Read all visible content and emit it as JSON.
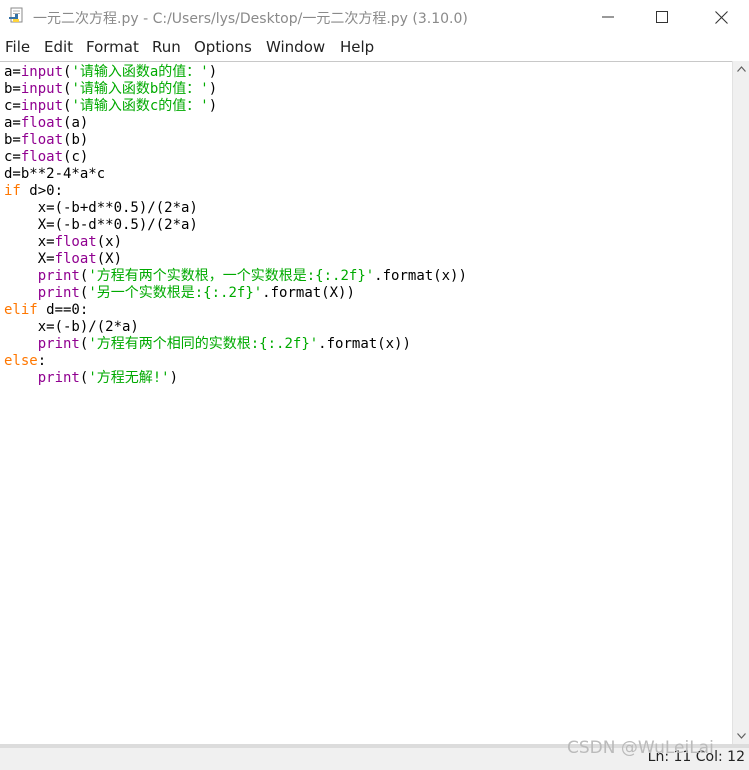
{
  "window": {
    "title": "一元二次方程.py - C:/Users/lys/Desktop/一元二次方程.py (3.10.0)"
  },
  "menu": [
    "File",
    "Edit",
    "Format",
    "Run",
    "Options",
    "Window",
    "Help"
  ],
  "code": [
    [
      {
        "t": "a="
      },
      {
        "t": "input",
        "c": "bi"
      },
      {
        "t": "("
      },
      {
        "t": "'请输入函数a的值：'",
        "c": "st"
      },
      {
        "t": ")"
      }
    ],
    [
      {
        "t": "b="
      },
      {
        "t": "input",
        "c": "bi"
      },
      {
        "t": "("
      },
      {
        "t": "'请输入函数b的值：'",
        "c": "st"
      },
      {
        "t": ")"
      }
    ],
    [
      {
        "t": "c="
      },
      {
        "t": "input",
        "c": "bi"
      },
      {
        "t": "("
      },
      {
        "t": "'请输入函数c的值：'",
        "c": "st"
      },
      {
        "t": ")"
      }
    ],
    [
      {
        "t": "a="
      },
      {
        "t": "float",
        "c": "bi"
      },
      {
        "t": "(a)"
      }
    ],
    [
      {
        "t": "b="
      },
      {
        "t": "float",
        "c": "bi"
      },
      {
        "t": "(b)"
      }
    ],
    [
      {
        "t": "c="
      },
      {
        "t": "float",
        "c": "bi"
      },
      {
        "t": "(c)"
      }
    ],
    [
      {
        "t": "d=b**2-4*a*c"
      }
    ],
    [
      {
        "t": "if",
        "c": "kw"
      },
      {
        "t": " d>0:"
      }
    ],
    [
      {
        "t": "    x=(-b+d**0.5)/(2*a)"
      }
    ],
    [
      {
        "t": "    X=(-b-d**0.5)/(2*a)"
      }
    ],
    [
      {
        "t": "    x="
      },
      {
        "t": "float",
        "c": "bi"
      },
      {
        "t": "(x)"
      }
    ],
    [
      {
        "t": "    X="
      },
      {
        "t": "float",
        "c": "bi"
      },
      {
        "t": "(X)"
      }
    ],
    [
      {
        "t": "    "
      },
      {
        "t": "print",
        "c": "bi"
      },
      {
        "t": "("
      },
      {
        "t": "'方程有两个实数根，一个实数根是:{:.2f}'",
        "c": "st"
      },
      {
        "t": ".format(x))"
      }
    ],
    [
      {
        "t": "    "
      },
      {
        "t": "print",
        "c": "bi"
      },
      {
        "t": "("
      },
      {
        "t": "'另一个实数根是:{:.2f}'",
        "c": "st"
      },
      {
        "t": ".format(X))"
      }
    ],
    [
      {
        "t": "elif",
        "c": "kw"
      },
      {
        "t": " d==0:"
      }
    ],
    [
      {
        "t": "    x=(-b)/(2*a)"
      }
    ],
    [
      {
        "t": "    "
      },
      {
        "t": "print",
        "c": "bi"
      },
      {
        "t": "("
      },
      {
        "t": "'方程有两个相同的实数根:{:.2f}'",
        "c": "st"
      },
      {
        "t": ".format(x))"
      }
    ],
    [
      {
        "t": "else",
        "c": "kw"
      },
      {
        "t": ":"
      }
    ],
    [
      {
        "t": "    "
      },
      {
        "t": "print",
        "c": "bi"
      },
      {
        "t": "("
      },
      {
        "t": "'方程无解!'",
        "c": "st"
      },
      {
        "t": ")"
      }
    ]
  ],
  "status": {
    "position": "Ln: 11   Col: 12"
  },
  "watermark": "CSDN @WuLeiLai",
  "colors": {
    "keyword": "#ff7700",
    "builtin": "#900090",
    "string": "#00aa00"
  },
  "icons": {
    "app": "python-idle-icon",
    "minimize": "minimize-icon",
    "maximize": "maximize-icon",
    "close": "close-icon"
  }
}
